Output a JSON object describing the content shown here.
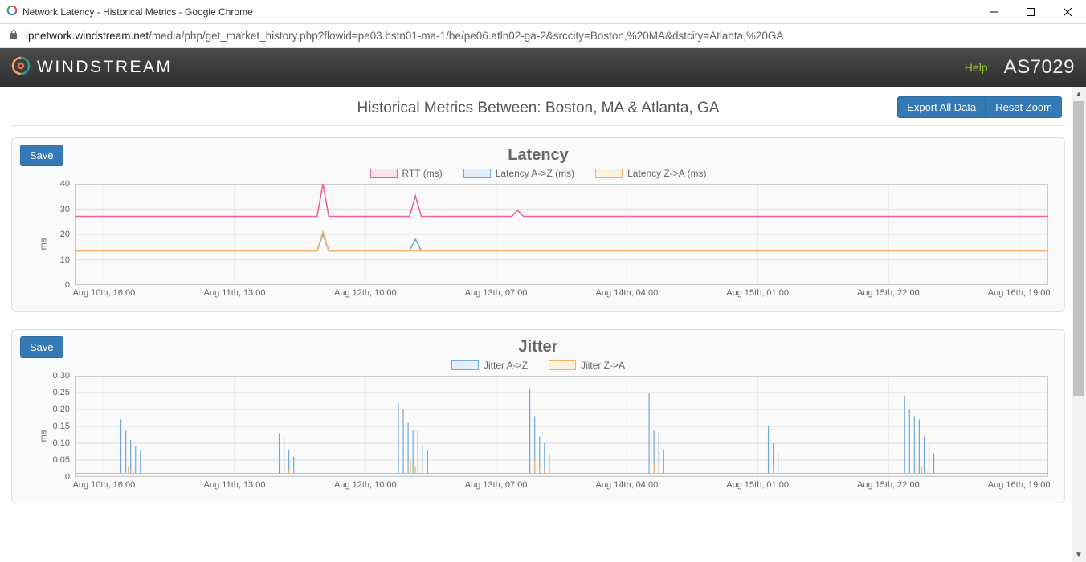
{
  "window": {
    "title": "Network Latency - Historical Metrics - Google Chrome"
  },
  "url": {
    "host": "ipnetwork.windstream.net",
    "path": "/media/php/get_market_history.php?flowid=pe03.bstn01-ma-1/be/pe06.atln02-ga-2&srccity=Boston,%20MA&dstcity=Atlanta,%20GA"
  },
  "brand": {
    "name": "WINDSTREAM",
    "help": "Help",
    "asn": "AS7029"
  },
  "page": {
    "title": "Historical Metrics Between: Boston, MA & Atlanta, GA",
    "export_btn": "Export All Data",
    "reset_btn": "Reset Zoom",
    "save_btn": "Save"
  },
  "xticks": [
    "Aug 10th, 16:00",
    "Aug 11th, 13:00",
    "Aug 12th, 10:00",
    "Aug 13th, 07:00",
    "Aug 14th, 04:00",
    "Aug 15th, 01:00",
    "Aug 15th, 22:00",
    "Aug 16th, 19:00"
  ],
  "latency": {
    "title": "Latency",
    "ylabel": "ms",
    "yticks": [
      "0",
      "10",
      "20",
      "30",
      "40"
    ],
    "legend": [
      {
        "label": "RTT (ms)",
        "stroke": "#f06292",
        "fill": "#fde4ec"
      },
      {
        "label": "Latency A->Z (ms)",
        "stroke": "#6fa8dc",
        "fill": "#e3f0fb"
      },
      {
        "label": "Latency Z->A (ms)",
        "stroke": "#f4b26b",
        "fill": "#fdf1e0"
      }
    ]
  },
  "jitter": {
    "title": "Jitter",
    "ylabel": "ms",
    "yticks": [
      "0",
      "0.05",
      "0.10",
      "0.15",
      "0.20",
      "0.25",
      "0.30"
    ],
    "legend": [
      {
        "label": "Jitter A->Z",
        "stroke": "#6fa8dc",
        "fill": "#e3f0fb"
      },
      {
        "label": "Jiiter Z->A",
        "stroke": "#f4b26b",
        "fill": "#fdf1e0"
      }
    ]
  },
  "chart_data": [
    {
      "type": "line",
      "title": "Latency",
      "xlabel": "",
      "ylabel": "ms",
      "ylim": [
        0,
        42
      ],
      "categories": [
        "Aug 10th, 16:00",
        "Aug 11th, 13:00",
        "Aug 12th, 10:00",
        "Aug 13th, 07:00",
        "Aug 14th, 04:00",
        "Aug 15th, 01:00",
        "Aug 15th, 22:00",
        "Aug 16th, 19:00"
      ],
      "series": [
        {
          "name": "RTT (ms)",
          "baseline": 28.5,
          "spikes": [
            {
              "x_pct": 25.5,
              "value": 42
            },
            {
              "x_pct": 35,
              "value": 37
            },
            {
              "x_pct": 45.5,
              "value": 31
            }
          ]
        },
        {
          "name": "Latency A->Z (ms)",
          "baseline": 14.2,
          "spikes": [
            {
              "x_pct": 25.5,
              "value": 21
            },
            {
              "x_pct": 35,
              "value": 19
            }
          ]
        },
        {
          "name": "Latency Z->A (ms)",
          "baseline": 14.2,
          "spikes": [
            {
              "x_pct": 25.5,
              "value": 22
            }
          ]
        }
      ]
    },
    {
      "type": "line",
      "title": "Jitter",
      "xlabel": "",
      "ylabel": "ms",
      "ylim": [
        0,
        0.3
      ],
      "categories": [
        "Aug 10th, 16:00",
        "Aug 11th, 13:00",
        "Aug 12th, 10:00",
        "Aug 13th, 07:00",
        "Aug 14th, 04:00",
        "Aug 15th, 01:00",
        "Aug 15th, 22:00",
        "Aug 16th, 19:00"
      ],
      "series": [
        {
          "name": "Jitter A->Z",
          "baseline": 0.01,
          "clusters": [
            {
              "x_pct": 6,
              "peaks": [
                0.17,
                0.14,
                0.11,
                0.09,
                0.08
              ]
            },
            {
              "x_pct": 22,
              "peaks": [
                0.13,
                0.12,
                0.08,
                0.06
              ]
            },
            {
              "x_pct": 35,
              "peaks": [
                0.22,
                0.2,
                0.16,
                0.14,
                0.14,
                0.1,
                0.08
              ]
            },
            {
              "x_pct": 48,
              "peaks": [
                0.26,
                0.18,
                0.12,
                0.1,
                0.07
              ]
            },
            {
              "x_pct": 60,
              "peaks": [
                0.25,
                0.14,
                0.13,
                0.08
              ]
            },
            {
              "x_pct": 72,
              "peaks": [
                0.15,
                0.1,
                0.07
              ]
            },
            {
              "x_pct": 87,
              "peaks": [
                0.24,
                0.2,
                0.18,
                0.17,
                0.12,
                0.09,
                0.07
              ]
            }
          ]
        },
        {
          "name": "Jiiter Z->A",
          "baseline": 0.01,
          "clusters": [
            {
              "x_pct": 6,
              "peaks": [
                0.03,
                0.02
              ]
            },
            {
              "x_pct": 22,
              "peaks": [
                0.04,
                0.02
              ]
            },
            {
              "x_pct": 35,
              "peaks": [
                0.05,
                0.03
              ]
            },
            {
              "x_pct": 48,
              "peaks": [
                0.05,
                0.03,
                0.02
              ]
            },
            {
              "x_pct": 60,
              "peaks": [
                0.04,
                0.02
              ]
            },
            {
              "x_pct": 72,
              "peaks": [
                0.03
              ]
            },
            {
              "x_pct": 87,
              "peaks": [
                0.04,
                0.03
              ]
            }
          ]
        }
      ]
    }
  ]
}
